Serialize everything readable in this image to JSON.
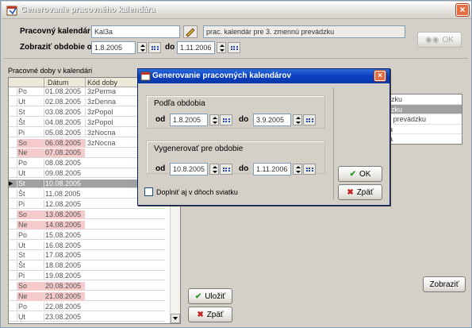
{
  "window": {
    "title": "Generovanie pracovného kalendára"
  },
  "header": {
    "calendar_label": "Pracovný kalendár",
    "calendar_value": "Kal3a",
    "calendar_desc": "prac. kalendár pre 3. zmennú prevádzku",
    "period_label": "Zobraziť obdobie od",
    "period_from": "1.8.2005",
    "period_to_label": "do",
    "period_to": "1.11.2006",
    "ok_label": "OK"
  },
  "grid": {
    "title": "Pracovné doby v kalendári",
    "columns": [
      "",
      "Dátum",
      "Kód doby"
    ],
    "rows": [
      {
        "day": "Po",
        "date": "01.08.2005",
        "code": "3zPerma",
        "weekend": false
      },
      {
        "day": "Ut",
        "date": "02.08.2005",
        "code": "3zDenna",
        "weekend": false
      },
      {
        "day": "St",
        "date": "03.08.2005",
        "code": "3zPopol",
        "weekend": false
      },
      {
        "day": "Št",
        "date": "04.08.2005",
        "code": "3zPopol",
        "weekend": false
      },
      {
        "day": "Pi",
        "date": "05.08.2005",
        "code": "3zNocna",
        "weekend": false
      },
      {
        "day": "So",
        "date": "06.08.2005",
        "code": "3zNocna",
        "weekend": true
      },
      {
        "day": "Ne",
        "date": "07.08.2005",
        "code": "",
        "weekend": true
      },
      {
        "day": "Po",
        "date": "08.08.2005",
        "code": "",
        "weekend": false
      },
      {
        "day": "Ut",
        "date": "09.08.2005",
        "code": "",
        "weekend": false
      },
      {
        "day": "St",
        "date": "10.08.2005",
        "code": "",
        "weekend": false,
        "selected": true
      },
      {
        "day": "Št",
        "date": "11.08.2005",
        "code": "",
        "weekend": false
      },
      {
        "day": "Pi",
        "date": "12.08.2005",
        "code": "",
        "weekend": false
      },
      {
        "day": "So",
        "date": "13.08.2005",
        "code": "",
        "weekend": true
      },
      {
        "day": "Ne",
        "date": "14.08.2005",
        "code": "",
        "weekend": true
      },
      {
        "day": "Po",
        "date": "15.08.2005",
        "code": "",
        "weekend": false
      },
      {
        "day": "Ut",
        "date": "16.08.2005",
        "code": "",
        "weekend": false
      },
      {
        "day": "St",
        "date": "17.08.2005",
        "code": "",
        "weekend": false
      },
      {
        "day": "Št",
        "date": "18.08.2005",
        "code": "",
        "weekend": false
      },
      {
        "day": "Pi",
        "date": "19.08.2005",
        "code": "",
        "weekend": false
      },
      {
        "day": "So",
        "date": "20.08.2005",
        "code": "",
        "weekend": true
      },
      {
        "day": "Ne",
        "date": "21.08.2005",
        "code": "",
        "weekend": true
      },
      {
        "day": "Po",
        "date": "22.08.2005",
        "code": "",
        "weekend": false
      },
      {
        "day": "Ut",
        "date": "23.08.2005",
        "code": "",
        "weekend": false
      }
    ]
  },
  "right_list": {
    "items": [
      {
        "text": "dzku",
        "selected": false
      },
      {
        "text": "dzku",
        "selected": true
      },
      {
        "text": "á prevádzku",
        "selected": false
      },
      {
        "text": "ia",
        "selected": false
      },
      {
        "text": "ia",
        "selected": false
      }
    ]
  },
  "buttons": {
    "save": "Uložiť",
    "back": "Zpäť",
    "show": "Zobraziť"
  },
  "dialog": {
    "title": "Generovanie pracovných kalendárov",
    "group1_label": "Podľa obdobia",
    "from_label": "od",
    "g1_from": "1.8.2005",
    "to_label": "do",
    "g1_to": "3.9.2005",
    "group2_label": "Vygenerovať pre obdobie",
    "g2_from": "10.8.2005",
    "g2_to": "1.11.2006",
    "holiday_label": "Doplniť aj v dňoch sviatku",
    "ok_label": "OK",
    "back_label": "Zpäť"
  },
  "colors": {
    "weekend_bg": "#f4caca",
    "selected_row": "#a0a0a0",
    "dialog_title": "#0a3fc1"
  }
}
